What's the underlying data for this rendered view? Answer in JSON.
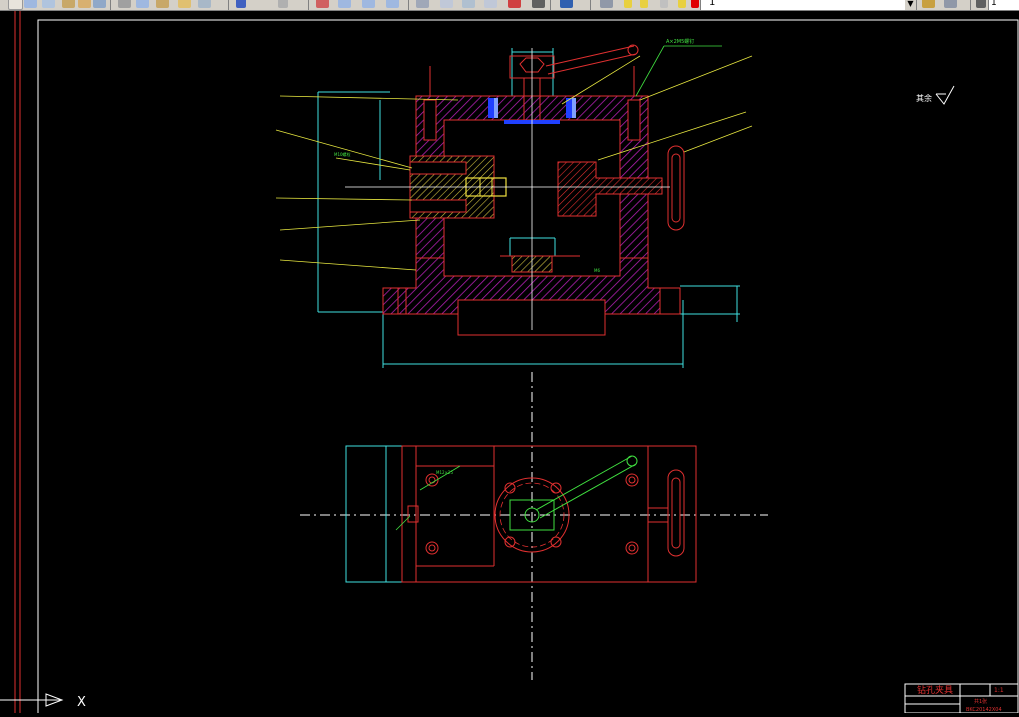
{
  "toolbar": {
    "layer_name": "1",
    "right_text": "1",
    "icons": [
      "new-icon",
      "open-icon",
      "save-icon",
      "print-icon",
      "preview-icon",
      "publish-icon",
      "cut-icon",
      "copy-icon",
      "paste-icon",
      "match-icon",
      "undo-icon",
      "redo-icon",
      "pan-icon",
      "zoom-realtime-icon",
      "zoom-window-icon",
      "zoom-previous-icon",
      "properties-icon",
      "design-center-icon",
      "tool-palette-icon",
      "sheet-set-icon",
      "markup-icon",
      "calc-icon",
      "help-icon",
      "layer-manager-icon",
      "layer-state-icon"
    ]
  },
  "drawing": {
    "annotations": {
      "part_spec": "A×2M5螺钉",
      "label_clamp": "M10螺栓",
      "label_bottom_note": "M6",
      "plan_note": "M12×25",
      "roughness_symbol_text": "其余"
    },
    "title_block": {
      "title": "钻孔夹具",
      "scale": "1:1",
      "sheet": "共1张",
      "code": "BKC20142X04"
    },
    "ucs_x_label": "X"
  }
}
